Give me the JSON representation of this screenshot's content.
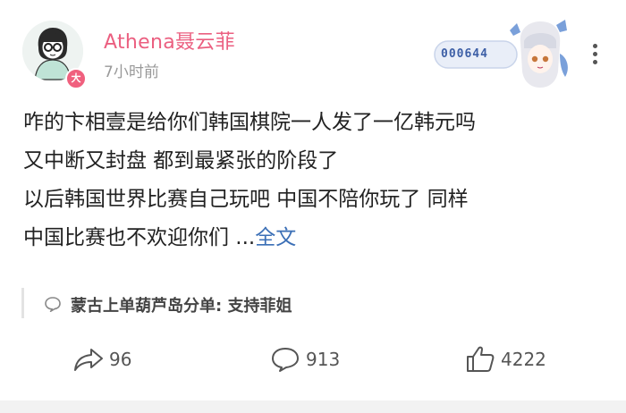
{
  "post": {
    "author": "Athena聂云菲",
    "vip_badge": "大",
    "time": "7小时前",
    "decoration_number": "000644",
    "content_lines": [
      "咋的卞相壹是给你们韩国棋院一人发了一亿韩元吗",
      "又中断又封盘 都到最紧张的阶段了",
      "以后韩国世界比赛自己玩吧 中国不陪你玩了 同样",
      "中国比赛也不欢迎你们 ..."
    ],
    "full_text_link": "全文"
  },
  "comment_preview": {
    "text": "蒙古上单葫芦岛分单: 支持菲姐"
  },
  "actions": {
    "share_count": "96",
    "comment_count": "913",
    "like_count": "4222"
  },
  "colors": {
    "username": "#eb5f80",
    "link": "#3b6fb6",
    "badge": "#f0607e"
  },
  "icons": [
    "share-icon",
    "comment-icon",
    "like-icon",
    "more-icon",
    "comment-bubble-icon"
  ]
}
